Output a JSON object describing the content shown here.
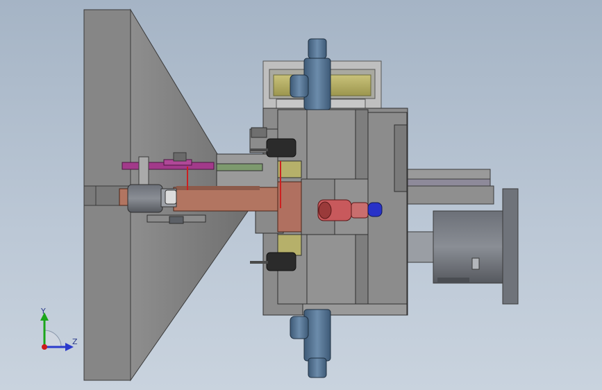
{
  "viewport": {
    "background_top": "#a5b4c5",
    "background_bottom": "#c9d3de",
    "model_colors": {
      "gray_body": "#8a8a8a",
      "dark_gray": "#5c6066",
      "yellow_spring": "#b8b26a",
      "magenta_arm": "#a23a8a",
      "copper_slide": "#b27561",
      "red_fitting": "#c8595c",
      "blue_knob": "#2832c8",
      "steel_blue_screw": "#4f6e8c",
      "green_strip": "#7d9a6e"
    }
  },
  "triad": {
    "y_label": "Y",
    "z_label": "Z",
    "y_color": "#1aa51a",
    "z_color": "#2a3acc",
    "x_color": "#cc1a1a"
  }
}
